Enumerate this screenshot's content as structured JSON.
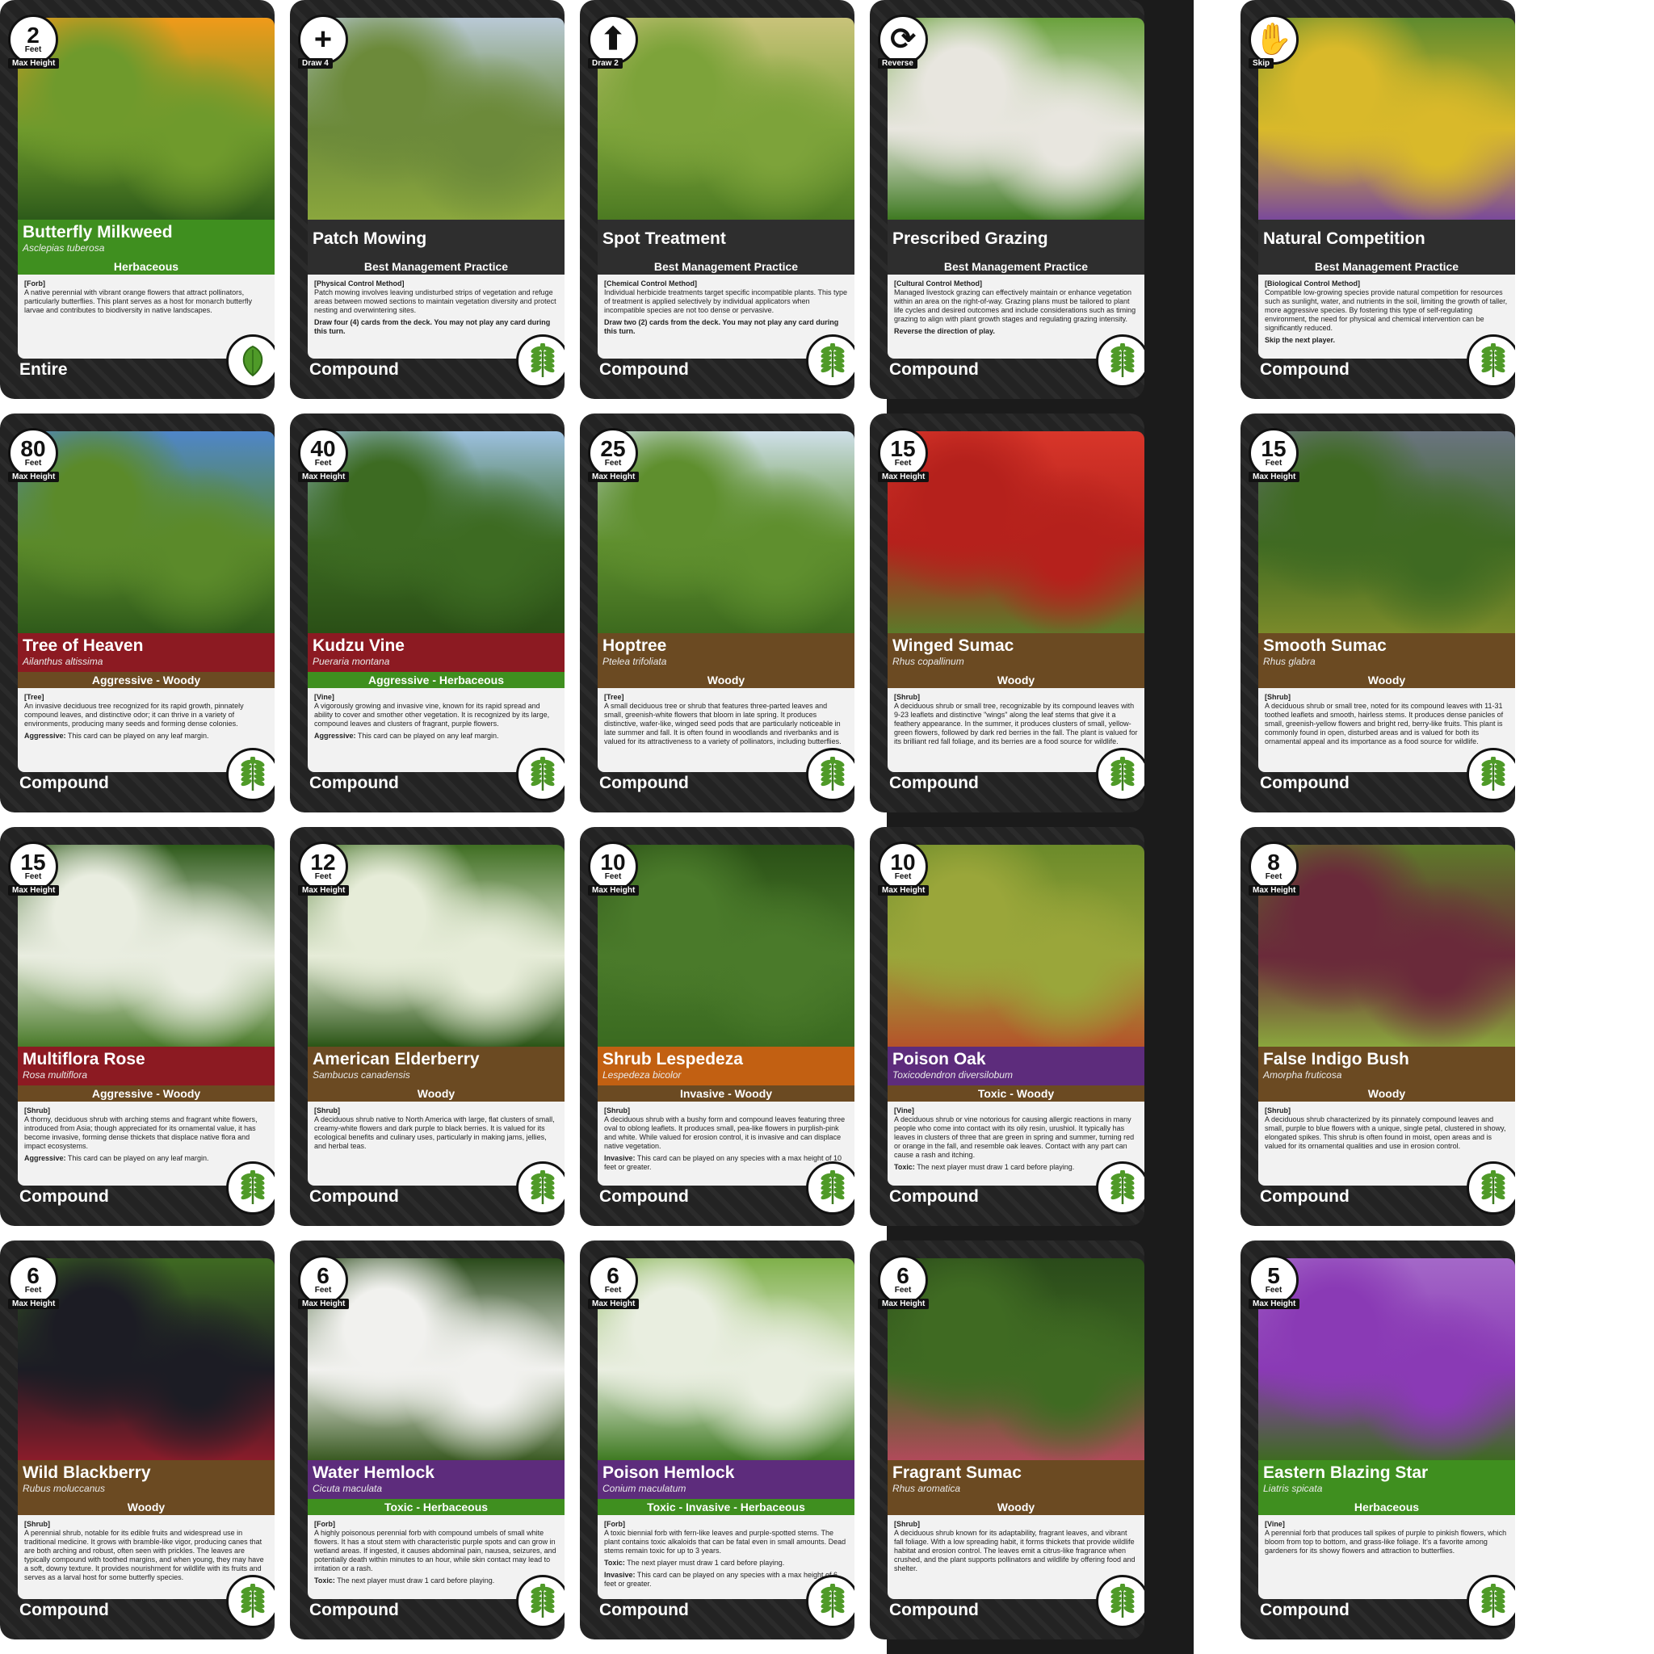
{
  "colors": {
    "herbaceous": "#3f8f1f",
    "bmp": "#2e2e2e",
    "aggressive": "#8c1a22",
    "woody": "#6b4a22",
    "invasive": "#c26012",
    "toxic": "#5d2c7c"
  },
  "cards": [
    {
      "badge_kind": "height",
      "value": "2",
      "unit": "Feet",
      "tag": "Max Height",
      "name": "Butterfly Milkweed",
      "sci": "Asclepias tuberosa",
      "category": "Herbaceous",
      "band": "herbaceous",
      "cat_color": "herbaceous",
      "type": "[Forb]",
      "text": "A native perennial with vibrant orange flowers that attract pollinators, particularly butterflies. This plant serves as a host for monarch butterfly larvae and contributes to biodiversity in native landscapes.",
      "ability_label": "",
      "ability": "",
      "leaf": "Entire",
      "leaf_icon": "entire-leaf-icon",
      "photo": [
        "#f09a1a",
        "#6f9a2c",
        "#2d5a1a"
      ]
    },
    {
      "badge_kind": "action",
      "icon": "+",
      "icon_name": "plus-icon",
      "tag": "Draw 4",
      "name": "Patch Mowing",
      "sci": "",
      "category": "Best Management Practice",
      "band": "bmp",
      "cat_color": "bmp",
      "type": "[Physical Control Method]",
      "text": "Patch mowing involves leaving undisturbed strips of vegetation and refuge areas between mowed sections to maintain vegetation diversity and protect nesting and overwintering sites.",
      "ability_label": "",
      "ability": "Draw four (4) cards from the deck. You may not play any card during this turn.",
      "leaf": "Compound",
      "leaf_icon": "compound-leaf-icon",
      "photo": [
        "#b9c9d6",
        "#6c8a3a",
        "#8aa63d"
      ]
    },
    {
      "badge_kind": "action",
      "icon": "⬆",
      "icon_name": "arrow-up-icon",
      "tag": "Draw 2",
      "name": "Spot Treatment",
      "sci": "",
      "category": "Best Management Practice",
      "band": "bmp",
      "cat_color": "bmp",
      "type": "[Chemical Control Method]",
      "text": "Individual herbicide treatments target specific incompatible plants. This type of treatment is applied selectively by individual applicators when incompatible species are not too dense or pervasive.",
      "ability_label": "",
      "ability": "Draw two (2) cards from the deck. You may not play any card during this turn.",
      "leaf": "Compound",
      "leaf_icon": "compound-leaf-icon",
      "photo": [
        "#c9c37a",
        "#7da33a",
        "#4c7a22"
      ]
    },
    {
      "badge_kind": "action",
      "icon": "⟳",
      "icon_name": "reverse-icon",
      "tag": "Reverse",
      "name": "Prescribed Grazing",
      "sci": "",
      "category": "Best Management Practice",
      "band": "bmp",
      "cat_color": "bmp",
      "type": "[Cultural Control Method]",
      "text": "Managed livestock grazing can effectively maintain or enhance vegetation within an area on the right-of-way. Grazing plans must be tailored to plant life cycles and desired outcomes and include considerations such as timing grazing to align with plant growth stages and regulating grazing intensity.",
      "ability_label": "",
      "ability": "Reverse the direction of play.",
      "leaf": "Compound",
      "leaf_icon": "compound-leaf-icon",
      "photo": [
        "#6aa13c",
        "#e8e6df",
        "#3f7a22"
      ]
    },
    {
      "badge_kind": "action",
      "icon": "✋",
      "icon_name": "skip-hand-icon",
      "tag": "Skip",
      "name": "Natural Competition",
      "sci": "",
      "category": "Best Management Practice",
      "band": "bmp",
      "cat_color": "bmp",
      "type": "[Biological Control Method]",
      "text": "Compatible low-growing species provide natural competition for resources such as sunlight, water, and nutrients in the soil, limiting the growth of taller, more aggressive species. By fostering this type of self-regulating environment, the need for physical and chemical intervention can be significantly reduced.",
      "ability_label": "",
      "ability": "Skip the next player.",
      "leaf": "Compound",
      "leaf_icon": "compound-leaf-icon",
      "photo": [
        "#5e8a2e",
        "#d9b92a",
        "#7a4a9a"
      ]
    },
    {
      "badge_kind": "height",
      "value": "80",
      "unit": "Feet",
      "tag": "Max Height",
      "name": "Tree of Heaven",
      "sci": "Ailanthus altissima",
      "category": "Aggressive - Woody",
      "band": "aggressive",
      "cat_color": "woody",
      "type": "[Tree]",
      "text": "An invasive deciduous tree recognized for its rapid growth, pinnately compound leaves, and distinctive odor; it can thrive in a variety of environments, producing many seeds and forming dense colonies.",
      "ability_label": "Aggressive:",
      "ability": "This card can be played on any leaf margin.",
      "leaf": "Compound",
      "leaf_icon": "compound-leaf-icon",
      "photo": [
        "#4f86c9",
        "#5b8a2a",
        "#2f5a1a"
      ]
    },
    {
      "badge_kind": "height",
      "value": "40",
      "unit": "Feet",
      "tag": "Max Height",
      "name": "Kudzu Vine",
      "sci": "Pueraria montana",
      "category": "Aggressive - Herbaceous",
      "band": "aggressive",
      "cat_color": "herbaceous",
      "type": "[Vine]",
      "text": "A vigorously growing and invasive vine, known for its rapid spread and ability to cover and smother other vegetation. It is recognized by its large, compound leaves and clusters of fragrant, purple flowers.",
      "ability_label": "Aggressive:",
      "ability": "This card can be played on any leaf margin.",
      "leaf": "Compound",
      "leaf_icon": "compound-leaf-icon",
      "photo": [
        "#9cc0e0",
        "#3d6b22",
        "#2a4f16"
      ]
    },
    {
      "badge_kind": "height",
      "value": "25",
      "unit": "Feet",
      "tag": "Max Height",
      "name": "Hoptree",
      "sci": "Ptelea trifoliata",
      "category": "Woody",
      "band": "woody",
      "cat_color": "woody",
      "type": "[Tree]",
      "text": "A small deciduous tree or shrub that features three-parted leaves and small, greenish-white flowers that bloom in late spring. It produces distinctive, wafer-like, winged seed pods that are particularly noticeable in late summer and fall. It is often found in woodlands and riverbanks and is valued for its attractiveness to a variety of pollinators, including butterflies.",
      "ability_label": "",
      "ability": "",
      "leaf": "Compound",
      "leaf_icon": "compound-leaf-icon",
      "photo": [
        "#cfe0ea",
        "#5f8f2e",
        "#3d6a1e"
      ]
    },
    {
      "badge_kind": "height",
      "value": "15",
      "unit": "Feet",
      "tag": "Max Height",
      "name": "Winged Sumac",
      "sci": "Rhus copallinum",
      "category": "Woody",
      "band": "woody",
      "cat_color": "woody",
      "type": "[Shrub]",
      "text": "A deciduous shrub or small tree, recognizable by its compound leaves with 9-23 leaflets and distinctive \"wings\" along the leaf stems that give it a feathery appearance. In the summer, it produces clusters of small, yellow-green flowers, followed by dark red berries in the fall. The plant is valued for its brilliant red fall foliage, and its berries are a food source for wildlife.",
      "ability_label": "",
      "ability": "",
      "leaf": "Compound",
      "leaf_icon": "compound-leaf-icon",
      "photo": [
        "#d8362a",
        "#b5211c",
        "#5c7a2a"
      ]
    },
    {
      "badge_kind": "height",
      "value": "15",
      "unit": "Feet",
      "tag": "Max Height",
      "name": "Smooth Sumac",
      "sci": "Rhus glabra",
      "category": "Woody",
      "band": "woody",
      "cat_color": "woody",
      "type": "[Shrub]",
      "text": "A deciduous shrub or small tree, noted for its compound leaves with 11-31 toothed leaflets and smooth, hairless stems. It produces dense panicles of small, greenish-yellow flowers and bright red, berry-like fruits. This plant is commonly found in open, disturbed areas and is valued for both its ornamental appeal and its importance as a food source for wildlife.",
      "ability_label": "",
      "ability": "",
      "leaf": "Compound",
      "leaf_icon": "compound-leaf-icon",
      "photo": [
        "#6a7480",
        "#3f6a22",
        "#7a8a2a"
      ]
    },
    {
      "badge_kind": "height",
      "value": "15",
      "unit": "Feet",
      "tag": "Max Height",
      "name": "Multiflora Rose",
      "sci": "Rosa multiflora",
      "category": "Aggressive - Woody",
      "band": "aggressive",
      "cat_color": "woody",
      "type": "[Shrub]",
      "text": "A thorny, deciduous shrub with arching stems and fragrant white flowers, introduced from Asia; though appreciated for its ornamental value, it has become invasive, forming dense thickets that displace native flora and impact ecosystems.",
      "ability_label": "Aggressive:",
      "ability": "This card can be played on any leaf margin.",
      "leaf": "Compound",
      "leaf_icon": "compound-leaf-icon",
      "photo": [
        "#2e5a1a",
        "#e9ede0",
        "#4a7a2a"
      ]
    },
    {
      "badge_kind": "height",
      "value": "12",
      "unit": "Feet",
      "tag": "Max Height",
      "name": "American Elderberry",
      "sci": "Sambucus canadensis",
      "category": "Woody",
      "band": "woody",
      "cat_color": "woody",
      "type": "[Shrub]",
      "text": "A deciduous shrub native to North America with large, flat clusters of small, creamy-white flowers and dark purple to black berries. It is valued for its ecological benefits and culinary uses, particularly in making jams, jellies, and herbal teas.",
      "ability_label": "",
      "ability": "",
      "leaf": "Compound",
      "leaf_icon": "compound-leaf-icon",
      "photo": [
        "#3f6e22",
        "#e6ecd8",
        "#2b5516"
      ]
    },
    {
      "badge_kind": "height",
      "value": "10",
      "unit": "Feet",
      "tag": "Max Height",
      "name": "Shrub Lespedeza",
      "sci": "Lespedeza bicolor",
      "category": "Invasive - Woody",
      "band": "invasive",
      "cat_color": "woody",
      "type": "[Shrub]",
      "text": "A deciduous shrub with a bushy form and compound leaves featuring three oval to oblong leaflets. It produces small, pea-like flowers in purplish-pink and white. While valued for erosion control, it is invasive and can displace native vegetation.",
      "ability_label": "Invasive:",
      "ability": "This card can be played on any species with a max height of 10 feet or greater.",
      "leaf": "Compound",
      "leaf_icon": "compound-leaf-icon",
      "photo": [
        "#2a5016",
        "#4a7a2a",
        "#3a6a20"
      ]
    },
    {
      "badge_kind": "height",
      "value": "10",
      "unit": "Feet",
      "tag": "Max Height",
      "name": "Poison Oak",
      "sci": "Toxicodendron diversilobum",
      "category": "Toxic - Woody",
      "band": "toxic",
      "cat_color": "woody",
      "type": "[Vine]",
      "text": "A deciduous shrub or vine notorious for causing allergic reactions in many people who come into contact with its oily resin, urushiol. It typically has leaves in clusters of three that are green in spring and summer, turning red or orange in the fall, and resemble oak leaves. Contact with any part can cause a rash and itching.",
      "ability_label": "Toxic:",
      "ability": "The next player must draw 1 card before playing.",
      "leaf": "Compound",
      "leaf_icon": "compound-leaf-icon",
      "photo": [
        "#6b8a2a",
        "#9aa63a",
        "#b5532a"
      ]
    },
    {
      "badge_kind": "height",
      "value": "8",
      "unit": "Feet",
      "tag": "Max Height",
      "name": "False Indigo Bush",
      "sci": "Amorpha fruticosa",
      "category": "Woody",
      "band": "woody",
      "cat_color": "woody",
      "type": "[Shrub]",
      "text": "A deciduous shrub characterized by its pinnately compound leaves and small, purple to blue flowers with a unique, single petal, clustered in showy, elongated spikes. This shrub is often found in moist, open areas and is valued for its ornamental qualities and use in erosion control.",
      "ability_label": "",
      "ability": "",
      "leaf": "Compound",
      "leaf_icon": "compound-leaf-icon",
      "photo": [
        "#5e7a2a",
        "#6a2a3a",
        "#8aa63d"
      ]
    },
    {
      "badge_kind": "height",
      "value": "6",
      "unit": "Feet",
      "tag": "Max Height",
      "name": "Wild Blackberry",
      "sci": "Rubus moluccanus",
      "category": "Woody",
      "band": "woody",
      "cat_color": "woody",
      "type": "[Shrub]",
      "text": "A perennial shrub, notable for its edible fruits and widespread use in traditional medicine. It grows with bramble-like vigor, producing canes that are both arching and robust, often seen with prickles. The leaves are typically compound with toothed margins, and when young, they may have a soft, downy texture. It provides nourishment for wildlife with its fruits and serves as a larval host for some butterfly species.",
      "ability_label": "",
      "ability": "",
      "leaf": "Compound",
      "leaf_icon": "compound-leaf-icon",
      "photo": [
        "#3f6a22",
        "#1c1c24",
        "#8a1c2a"
      ]
    },
    {
      "badge_kind": "height",
      "value": "6",
      "unit": "Feet",
      "tag": "Max Height",
      "name": "Water Hemlock",
      "sci": "Cicuta maculata",
      "category": "Toxic - Herbaceous",
      "band": "toxic",
      "cat_color": "herbaceous",
      "type": "[Forb]",
      "text": "A highly poisonous perennial forb with compound umbels of small white flowers. It has a stout stem with characteristic purple spots and can grow in wetland areas. If ingested, it causes abdominal pain, nausea, seizures, and potentially death within minutes to an hour, while skin contact may lead to irritation or a rash.",
      "ability_label": "Toxic:",
      "ability": "The next player must draw 1 card before playing.",
      "leaf": "Compound",
      "leaf_icon": "compound-leaf-icon",
      "photo": [
        "#2a4a1a",
        "#f1f1ee",
        "#3a5a22"
      ]
    },
    {
      "badge_kind": "height",
      "value": "6",
      "unit": "Feet",
      "tag": "Max Height",
      "name": "Poison Hemlock",
      "sci": "Conium maculatum",
      "category": "Toxic - Invasive - Herbaceous",
      "band": "toxic",
      "cat_color": "herbaceous",
      "type": "[Forb]",
      "text": "A toxic biennial forb with fern-like leaves and purple-spotted stems. The plant contains toxic alkaloids that can be fatal even in small amounts. Dead stems remain toxic for up to 3 years.",
      "ability_label": "Toxic:",
      "ability": "The next player must draw 1 card before playing.",
      "ability2_label": "Invasive:",
      "ability2": "This card can be played on any species with a max height of 6 feet or greater.",
      "leaf": "Compound",
      "leaf_icon": "compound-leaf-icon",
      "photo": [
        "#7fb04a",
        "#e9eee0",
        "#3f7a22"
      ]
    },
    {
      "badge_kind": "height",
      "value": "6",
      "unit": "Feet",
      "tag": "Max Height",
      "name": "Fragrant Sumac",
      "sci": "Rhus aromatica",
      "category": "Woody",
      "band": "woody",
      "cat_color": "woody",
      "type": "[Shrub]",
      "text": "A deciduous shrub known for its adaptability, fragrant leaves, and vibrant fall foliage. With a low spreading habit, it forms thickets that provide wildlife habitat and erosion control. The leaves emit a citrus-like fragrance when crushed, and the plant supports pollinators and wildlife by offering food and shelter.",
      "ability_label": "",
      "ability": "",
      "leaf": "Compound",
      "leaf_icon": "compound-leaf-icon",
      "photo": [
        "#2a4a1a",
        "#3f6a22",
        "#b04a5a"
      ]
    },
    {
      "badge_kind": "height",
      "value": "5",
      "unit": "Feet",
      "tag": "Max Height",
      "name": "Eastern Blazing Star",
      "sci": "Liatris spicata",
      "category": "Herbaceous",
      "band": "herbaceous",
      "cat_color": "herbaceous",
      "type": "[Vine]",
      "text": "A perennial forb that produces tall spikes of purple to pinkish flowers, which bloom from top to bottom, and grass-like foliage. It's a favorite among gardeners for its showy flowers and attraction to butterflies.",
      "ability_label": "",
      "ability": "",
      "leaf": "Compound",
      "leaf_icon": "compound-leaf-icon",
      "photo": [
        "#a468c8",
        "#8a3ab5",
        "#3f6a22"
      ]
    }
  ]
}
